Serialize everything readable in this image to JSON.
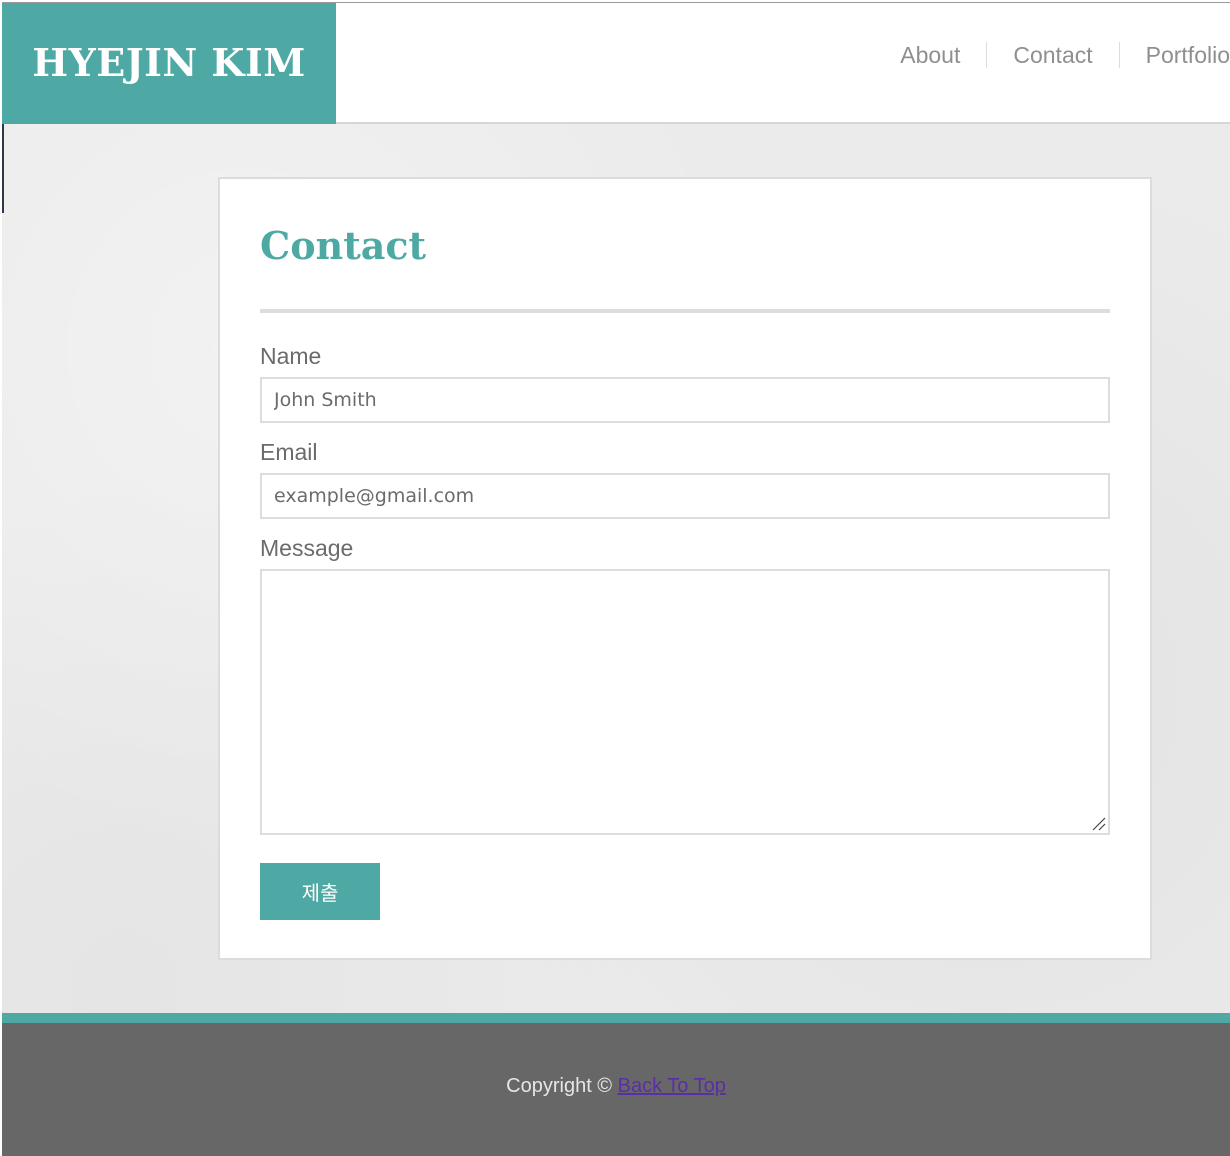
{
  "header": {
    "logo": "HYEJIN KIM",
    "nav": [
      {
        "label": "About"
      },
      {
        "label": "Contact"
      },
      {
        "label": "Portfolio"
      }
    ]
  },
  "contact": {
    "title": "Contact",
    "fields": {
      "name": {
        "label": "Name",
        "value": "John Smith"
      },
      "email": {
        "label": "Email",
        "value": "example@gmail.com"
      },
      "message": {
        "label": "Message",
        "value": ""
      }
    },
    "submit_label": "제출"
  },
  "footer": {
    "copyright": "Copyright ©",
    "back_to_top": "Back To Top"
  },
  "colors": {
    "accent": "#4ea9a4",
    "footer_bg": "#676767",
    "link": "#5a2ea6"
  }
}
